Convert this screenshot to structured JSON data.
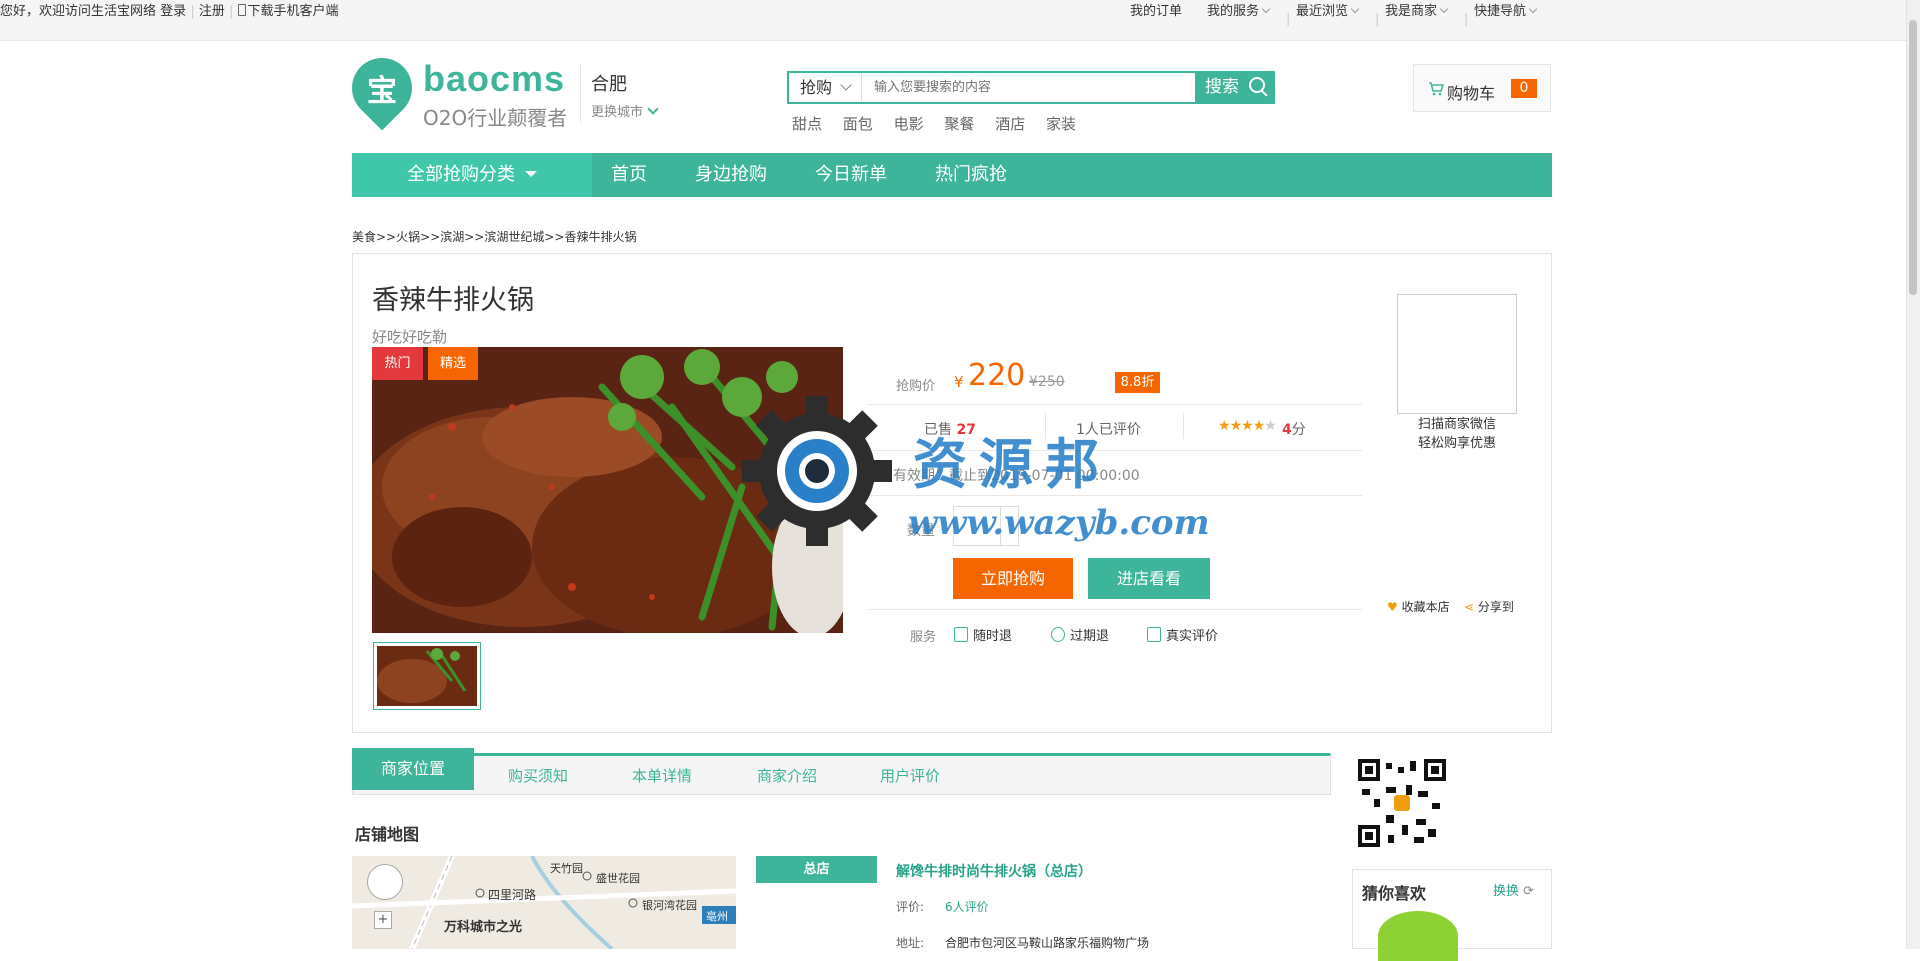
{
  "topbar": {
    "welcome": "您好，欢迎访问生活宝网络",
    "login": "登录",
    "register": "注册",
    "download": "下载手机客户端",
    "links": [
      "我的订单",
      "我的服务",
      "最近浏览",
      "我是商家",
      "快捷导航"
    ]
  },
  "header": {
    "logo_char": "宝",
    "logo_name": "baocms",
    "logo_slogan": "O2O行业颠覆者",
    "city": "合肥",
    "city_change": "更换城市"
  },
  "search": {
    "type": "抢购",
    "placeholder": "输入您要搜索的内容",
    "button": "搜索",
    "hotwords": [
      "甜点",
      "面包",
      "电影",
      "聚餐",
      "酒店",
      "家装"
    ]
  },
  "cart": {
    "label": "购物车",
    "count": "0"
  },
  "nav": {
    "all": "全部抢购分类",
    "items": [
      "首页",
      "身边抢购",
      "今日新单",
      "热门疯抢"
    ]
  },
  "breadcrumb": "美食>>火锅>>滨湖>>滨湖世纪城>>香辣牛排火锅",
  "product": {
    "title": "香辣牛排火锅",
    "subtitle": "好吃好吃勒",
    "badges": [
      "热门",
      "精选"
    ],
    "price_label": "抢购价",
    "currency": "¥",
    "price": "220",
    "old_price": "¥250",
    "discount": "8.8折",
    "sold_label": "已售",
    "sold": "27",
    "reviews": "1人已评价",
    "rating_stars": 4,
    "rating": "4",
    "rating_unit": "分",
    "valid": "有效期：截止到2019-07-01 00:00:00",
    "qty_label": "数量",
    "buy_btn": "立即抢购",
    "shop_btn": "进店看看",
    "service_label": "服务",
    "services": [
      "随时退",
      "过期退",
      "真实评价"
    ],
    "qr_tip_1": "扫描商家微信",
    "qr_tip_2": "轻松购享优惠",
    "fav": "收藏本店",
    "share": "分享到"
  },
  "watermark": {
    "cn": "资源邦",
    "url": "www.wazyb.com"
  },
  "tabs": [
    "商家位置",
    "购买须知",
    "本单详情",
    "商家介绍",
    "用户评价"
  ],
  "store": {
    "map_title": "店铺地图",
    "map_labels": [
      "天竹园",
      "盛世花园",
      "四里河路",
      "银河湾花园",
      "万科城市之光",
      "亳州"
    ],
    "branch_tag": "总店",
    "branch_name": "解馋牛排时尚牛排火锅（总店）",
    "rate_label": "评价:",
    "rate_value": "6人评价",
    "addr_label": "地址:",
    "addr_value": "合肥市包河区马鞍山路家乐福购物广场"
  },
  "guess": {
    "title": "猜你喜欢",
    "switch": "换换"
  },
  "colors": {
    "brand": "#3eb49a",
    "accent": "#f56600",
    "hot": "#e4393c"
  }
}
